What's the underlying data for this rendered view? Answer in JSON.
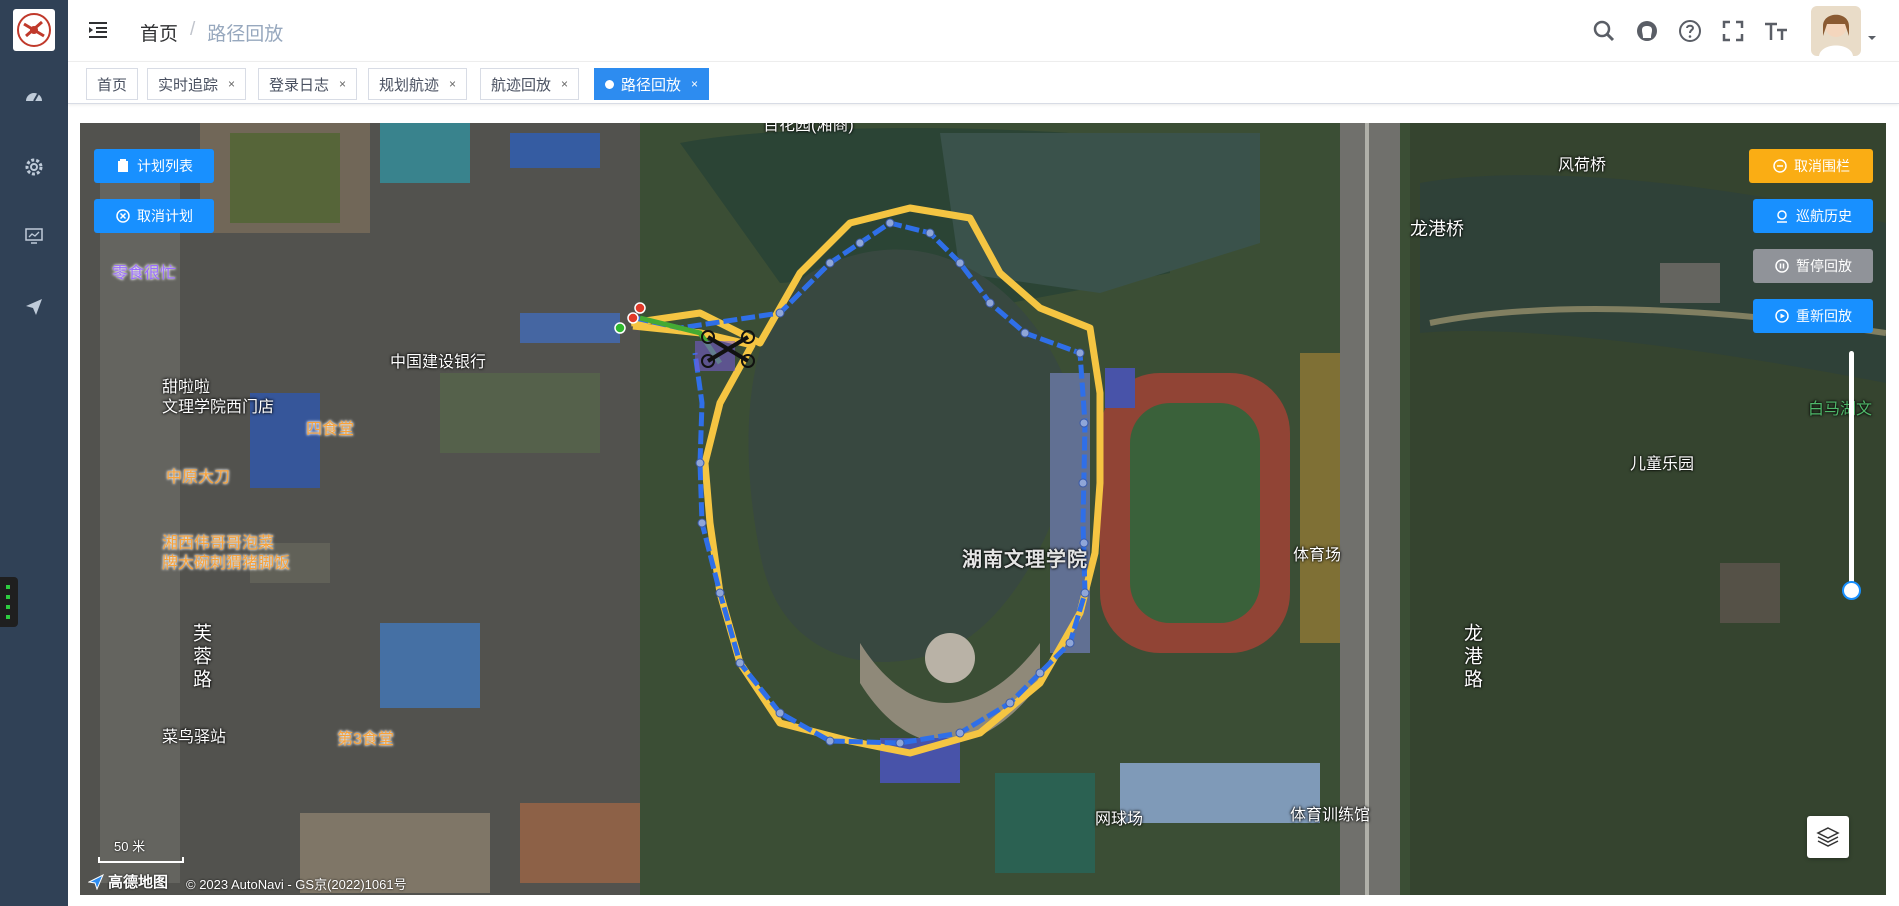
{
  "breadcrumb": {
    "home": "首页",
    "separator": "/",
    "current": "路径回放"
  },
  "sidebar": {
    "icons": [
      "dashboard-icon",
      "settings-icon",
      "monitor-icon",
      "send-icon"
    ]
  },
  "tags": [
    {
      "label": "首页",
      "closable": false,
      "active": false
    },
    {
      "label": "实时追踪",
      "closable": true,
      "active": false
    },
    {
      "label": "登录日志",
      "closable": true,
      "active": false
    },
    {
      "label": "规划航迹",
      "closable": true,
      "active": false
    },
    {
      "label": "航迹回放",
      "closable": true,
      "active": false
    },
    {
      "label": "路径回放",
      "closable": true,
      "active": true
    }
  ],
  "tag_close": "×",
  "map_buttons": {
    "plan_list": "计划列表",
    "cancel_plan": "取消计划",
    "cancel_fence": "取消围栏",
    "patrol_history": "巡航历史",
    "pause_replay": "暂停回放",
    "restart_replay": "重新回放"
  },
  "map_labels": {
    "top_cut": "百花园(湘商)",
    "snack": "零食很忙",
    "bank": "中国建设银行",
    "tea": "甜啦啦",
    "tea2": "文理学院西门店",
    "canteen4": "四食堂",
    "knife": "中原大刀",
    "hunan_food": "湘西伟哥哥泡菜",
    "hunan_food2": "牌大碗刺猬猪脚饭",
    "furong": "芙蓉路",
    "cainiao": "菜鸟驿站",
    "canteen3": "第3食堂",
    "campus": "湖南文理学院",
    "stadium": "体育场",
    "longgang_bridge": "龙港桥",
    "longgang_rd": "龙港路",
    "fenghe": "风荷桥",
    "kids": "儿童乐园",
    "baima": "白马湖文",
    "tennis": "网球场",
    "gym": "体育训练馆"
  },
  "scale_label": "50 米",
  "brand": "高德地图",
  "copyright": "© 2023 AutoNavi - GS京(2022)1061号",
  "colors": {
    "sidebar": "#304156",
    "primary": "#1890ff",
    "warning": "#faad14",
    "info": "#909399",
    "tag_active": "#2d8cf0",
    "route_planned": "#f5c542",
    "route_actual": "#2f6fe8"
  }
}
